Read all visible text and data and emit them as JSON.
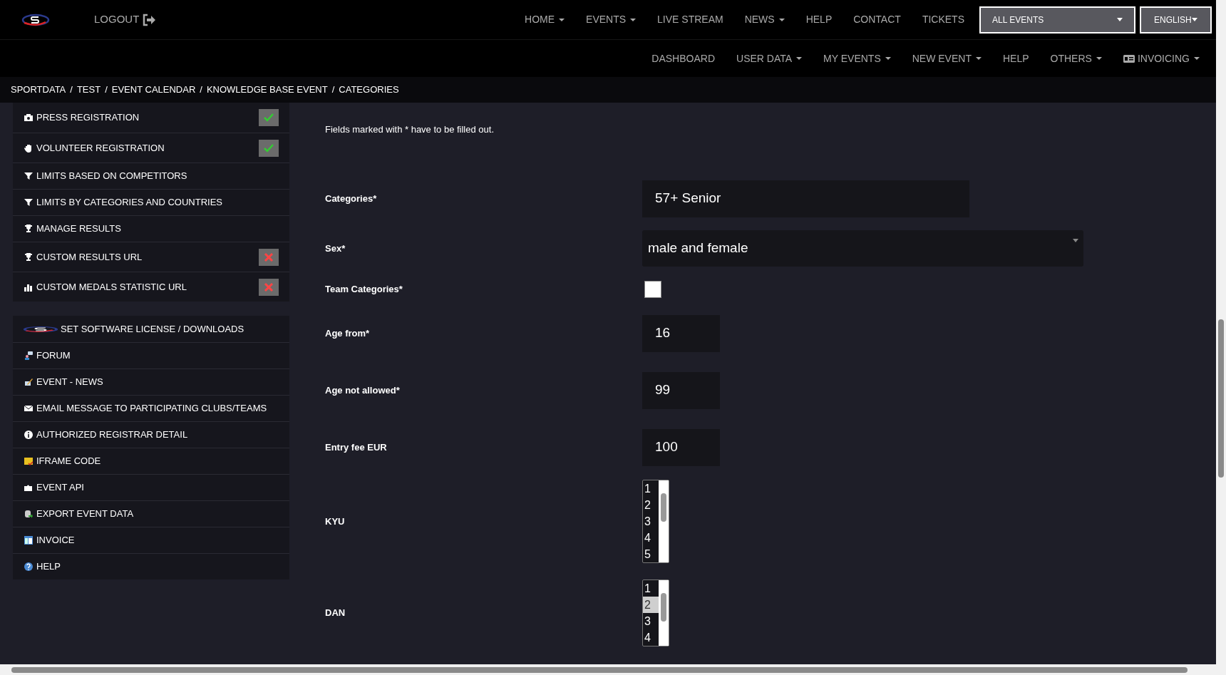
{
  "top_nav": {
    "logout": "LOGOUT",
    "items": [
      {
        "label": "HOME",
        "dropdown": true
      },
      {
        "label": "EVENTS",
        "dropdown": true
      },
      {
        "label": "LIVE STREAM",
        "dropdown": false
      },
      {
        "label": "NEWS",
        "dropdown": true
      },
      {
        "label": "HELP",
        "dropdown": false
      },
      {
        "label": "CONTACT",
        "dropdown": false
      },
      {
        "label": "TICKETS",
        "dropdown": false
      }
    ],
    "event_select": "ALL EVENTS",
    "language_select": "ENGLISH"
  },
  "sub_nav": [
    {
      "label": "DASHBOARD",
      "dropdown": false
    },
    {
      "label": "USER DATA",
      "dropdown": true
    },
    {
      "label": "MY EVENTS",
      "dropdown": true
    },
    {
      "label": "NEW EVENT",
      "dropdown": true
    },
    {
      "label": "HELP",
      "dropdown": false
    },
    {
      "label": "OTHERS",
      "dropdown": true
    },
    {
      "label": "INVOICING",
      "dropdown": true
    }
  ],
  "breadcrumb": [
    {
      "label": "SPORTDATA",
      "separator": "/"
    },
    {
      "label": "TEST",
      "separator": "/"
    },
    {
      "label": "EVENT CALENDAR",
      "separator": "/"
    },
    {
      "label": "KNOWLEDGE BASE EVENT",
      "separator": "/"
    },
    {
      "label": "CATEGORIES"
    }
  ],
  "sidebar": {
    "panels": [
      [
        {
          "label": "PRESS REGISTRATION",
          "kind": "toggle",
          "enabled": true
        },
        {
          "label": "VOLUNTEER REGISTRATION",
          "kind": "toggle",
          "enabled": true
        },
        {
          "label": "LIMITS BASED ON COMPETITORS",
          "kind": "link"
        },
        {
          "label": "LIMITS BY CATEGORIES AND COUNTRIES",
          "kind": "link"
        },
        {
          "label": "MANAGE RESULTS",
          "kind": "link"
        },
        {
          "label": "CUSTOM RESULTS URL",
          "kind": "toggle",
          "enabled": false
        },
        {
          "label": "CUSTOM MEDALS STATISTIC URL",
          "kind": "toggle",
          "enabled": false
        }
      ],
      [
        {
          "label": "SET SOFTWARE LICENSE / DOWNLOADS",
          "kind": "link"
        },
        {
          "label": "FORUM",
          "kind": "link"
        },
        {
          "label": "EVENT - NEWS",
          "kind": "link"
        },
        {
          "label": "EMAIL MESSAGE TO PARTICIPATING CLUBS/TEAMS",
          "kind": "link"
        },
        {
          "label": "AUTHORIZED REGISTRAR DETAIL",
          "kind": "link"
        },
        {
          "label": "IFRAME CODE",
          "kind": "link"
        },
        {
          "label": "EVENT API",
          "kind": "link"
        },
        {
          "label": "EXPORT EVENT DATA",
          "kind": "link"
        },
        {
          "label": "INVOICE",
          "kind": "link"
        },
        {
          "label": "HELP",
          "kind": "link"
        }
      ]
    ]
  },
  "form": {
    "note": "Fields marked with * have to be filled out.",
    "fields": [
      {
        "label": "Categories*",
        "kind": "text",
        "value": "57+ Senior"
      },
      {
        "label": "Sex*",
        "kind": "select",
        "value": "male and female"
      },
      {
        "label": "Team Categories*",
        "kind": "checkbox",
        "checked": false
      },
      {
        "label": "Age from*",
        "kind": "number",
        "value": "16"
      },
      {
        "label": "Age not allowed*",
        "kind": "number",
        "value": "99"
      },
      {
        "label": "Entry fee EUR",
        "kind": "number",
        "value": "100"
      },
      {
        "label": "KYU",
        "kind": "listbox",
        "options": [
          {
            "label": "1",
            "selected": false
          },
          {
            "label": "2",
            "selected": false
          },
          {
            "label": "3",
            "selected": false
          },
          {
            "label": "4",
            "selected": false
          },
          {
            "label": "5",
            "selected": false
          }
        ]
      },
      {
        "label": "DAN",
        "kind": "listbox",
        "options": [
          {
            "label": "1",
            "selected": false
          },
          {
            "label": "2",
            "selected": true
          },
          {
            "label": "3",
            "selected": false
          },
          {
            "label": "4",
            "selected": false
          }
        ]
      }
    ]
  }
}
